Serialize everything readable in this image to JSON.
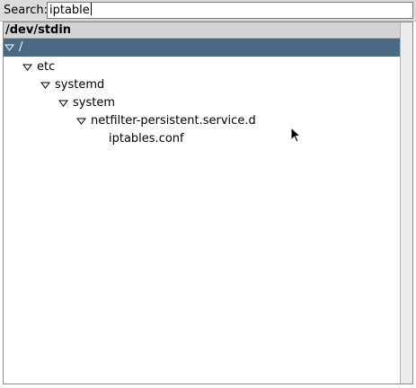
{
  "search": {
    "label": "Search:",
    "value": "iptable"
  },
  "tree": {
    "header": "/dev/stdin",
    "rows": [
      {
        "label": "/",
        "expanded": true,
        "selected": true
      },
      {
        "label": "etc",
        "expanded": true,
        "selected": false
      },
      {
        "label": "systemd",
        "expanded": true,
        "selected": false
      },
      {
        "label": "system",
        "expanded": true,
        "selected": false
      },
      {
        "label": "netfilter-persistent.service.d",
        "expanded": true,
        "selected": false
      },
      {
        "label": "iptables.conf",
        "expanded": false,
        "selected": false
      }
    ]
  },
  "icons": {
    "expand": "chevron-down-icon",
    "pointer": "mouse-pointer-icon"
  },
  "colors": {
    "selection": "#4a6984",
    "toolbar": "#dcdcdc"
  }
}
